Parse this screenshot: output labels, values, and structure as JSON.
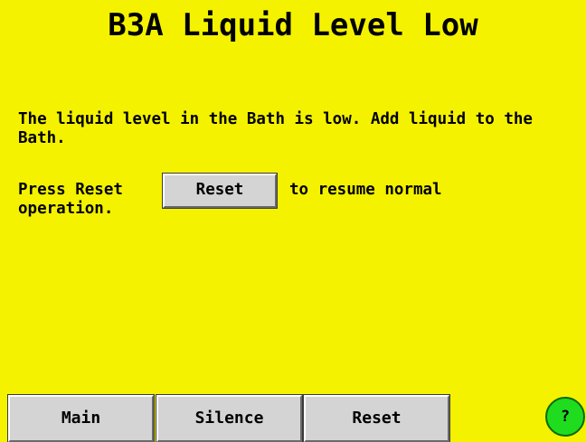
{
  "alarm": {
    "title": "B3A Liquid Level Low",
    "message": "The liquid level in the Bath is low. Add liquid to the Bath.",
    "instruction_lead": "Press Reset",
    "instruction_trail": "to resume normal",
    "instruction_cont": "operation.",
    "inline_reset_label": "Reset"
  },
  "bottom_bar": {
    "main_label": "Main",
    "silence_label": "Silence",
    "reset_label": "Reset"
  },
  "help": {
    "label": "?",
    "icon": "help-icon",
    "color": "#1fdc1f"
  },
  "colors": {
    "background": "#f5f200",
    "button": "#d4d4d4",
    "text": "#000000"
  }
}
